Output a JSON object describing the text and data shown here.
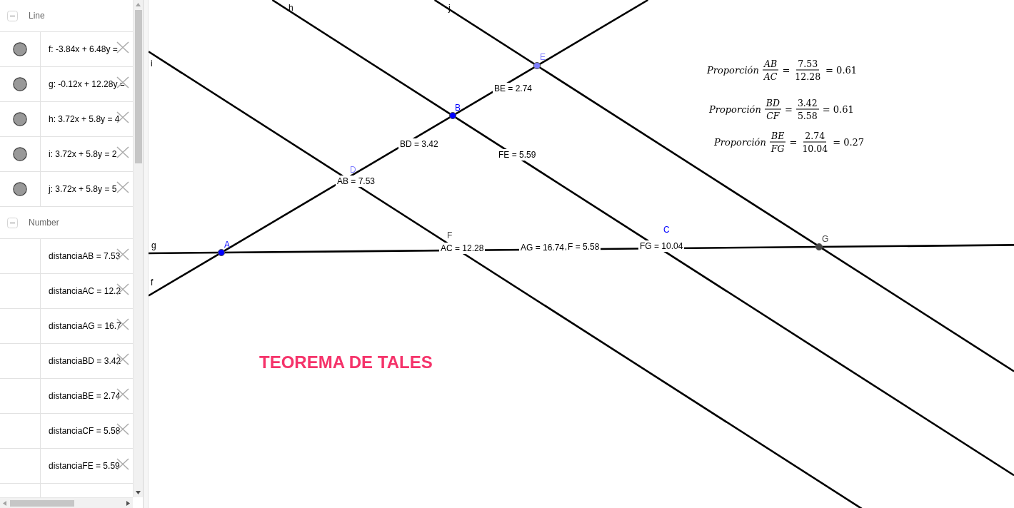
{
  "sidebar": {
    "groups": [
      {
        "title": "Line",
        "expanded": true,
        "items": [
          {
            "text": "f: -3.84x + 6.48y =",
            "visible": true
          },
          {
            "text": "g: -0.12x + 12.28y =",
            "visible": true
          },
          {
            "text": "h: 3.72x + 5.8y = 4",
            "visible": true
          },
          {
            "text": "i: 3.72x + 5.8y = 2",
            "visible": true
          },
          {
            "text": "j: 3.72x + 5.8y = 5",
            "visible": true
          }
        ]
      },
      {
        "title": "Number",
        "expanded": true,
        "items": [
          {
            "text": "distanciaAB = 7.53"
          },
          {
            "text": "distanciaAC = 12.2"
          },
          {
            "text": "distanciaAG = 16.7"
          },
          {
            "text": "distanciaBD = 3.42"
          },
          {
            "text": "distanciaBE = 2.74"
          },
          {
            "text": "distanciaCF = 5.58"
          },
          {
            "text": "distanciaFE = 5.59"
          }
        ]
      }
    ]
  },
  "canvas": {
    "lines": [
      {
        "label": "h"
      },
      {
        "label": "j"
      },
      {
        "label": "i"
      },
      {
        "label": "g"
      },
      {
        "label": "f"
      }
    ],
    "points": [
      {
        "label": "A",
        "color": "#0000ff",
        "dot": true
      },
      {
        "label": "B",
        "color": "#0000ff",
        "dot": true
      },
      {
        "label": "C",
        "color": "#0000ff",
        "dot": false
      },
      {
        "label": "D",
        "color": "#7f7fff",
        "dot": false
      },
      {
        "label": "E",
        "color": "#7f7fff",
        "dot": true
      },
      {
        "label": "F",
        "color": "#444444",
        "dot": false
      },
      {
        "label": "G",
        "color": "#444444",
        "dot": true
      }
    ],
    "measurements": [
      "AB = 7.53",
      "BD = 3.42",
      "BE = 2.74",
      "FE = 5.59",
      "AC = 12.28",
      "AG = 16.74",
      "F = 5.58",
      "FG = 10.04"
    ],
    "formulas": [
      {
        "parts": [
          {
            "kind": "label",
            "text": "Proporción"
          },
          {
            "kind": "ratio",
            "numerator": "AB",
            "denominator": "AC"
          },
          {
            "kind": "operator",
            "text": "="
          },
          {
            "kind": "quotient",
            "numerator": "7.53",
            "denominator": "12.28"
          },
          {
            "kind": "operator",
            "text": "= 0.61"
          }
        ]
      },
      {
        "parts": [
          {
            "kind": "label",
            "text": "Proporción"
          },
          {
            "kind": "ratio",
            "numerator": "BD",
            "denominator": "CF"
          },
          {
            "kind": "operator",
            "text": "="
          },
          {
            "kind": "quotient",
            "numerator": "3.42",
            "denominator": "5.58"
          },
          {
            "kind": "operator",
            "text": "= 0.61"
          }
        ]
      },
      {
        "parts": [
          {
            "kind": "label",
            "text": "Proporción"
          },
          {
            "kind": "ratio",
            "numerator": "BE",
            "denominator": "FG"
          },
          {
            "kind": "operator",
            "text": "="
          },
          {
            "kind": "quotient",
            "numerator": "2.74",
            "denominator": "10.04"
          },
          {
            "kind": "operator",
            "text": "= 0.27"
          }
        ]
      }
    ],
    "title": "TEOREMA DE TALES"
  }
}
